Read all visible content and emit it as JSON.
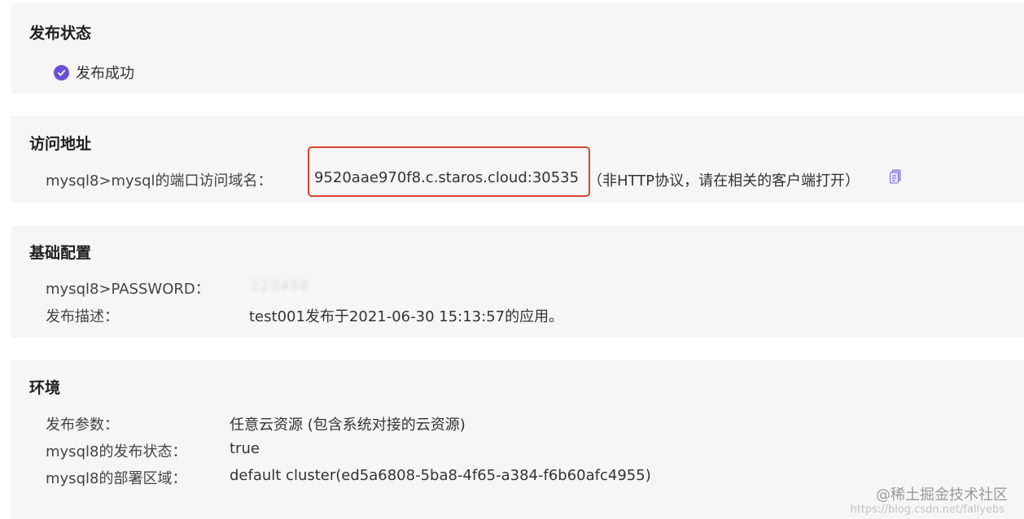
{
  "publish_status": {
    "title": "发布状态",
    "status_text": "发布成功"
  },
  "access_address": {
    "title": "访问地址",
    "label": "mysql8>mysql的端口访问域名：",
    "domain": "9520aae970f8.c.staros.cloud:30535",
    "note": "（非HTTP协议，请在相关的客户端打开）"
  },
  "basic_config": {
    "title": "基础配置",
    "password_label": "mysql8>PASSWORD：",
    "password_value": "123456",
    "desc_label": "发布描述：",
    "desc_value": "test001发布于2021-06-30 15:13:57的应用。"
  },
  "environment": {
    "title": "环境",
    "param_label": "发布参数：",
    "param_value": "任意云资源 (包含系统对接的云资源)",
    "state_label": "mysql8的发布状态：",
    "state_value": "true",
    "region_label": "mysql8的部署区域：",
    "region_value": "default cluster(ed5a6808-5ba8-4f65-a384-f6b60afc4955)"
  },
  "watermark": {
    "main": "@稀土掘金技术社区",
    "url": "https://blog.csdn.net/fallyebs"
  },
  "colors": {
    "accent": "#6b4fd6",
    "highlight_border": "#d9442f",
    "section_bg": "#f6f6f7"
  },
  "icons": {
    "status": "check-circle-icon",
    "copy": "copy-icon"
  }
}
